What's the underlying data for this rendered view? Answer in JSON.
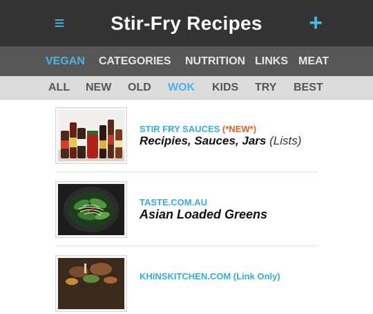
{
  "header": {
    "title": "Stir-Fry Recipes",
    "menu_icon": "≡",
    "add_icon": "+"
  },
  "colors": {
    "accent": "#49b6e3",
    "header_bg": "#333333",
    "nav_bg": "#575757",
    "subnav_bg": "#dcdcdc",
    "new_tag": "#e0612a"
  },
  "nav": {
    "items": [
      {
        "label": "VEGAN",
        "active": true
      },
      {
        "label": "CATEGORIES",
        "active": false
      },
      {
        "label": "NUTRITION",
        "active": false
      },
      {
        "label": "LINKS",
        "active": false
      },
      {
        "label": "MEAT",
        "active": false
      }
    ]
  },
  "subnav": {
    "items": [
      {
        "label": "ALL",
        "active": false
      },
      {
        "label": "NEW",
        "active": false
      },
      {
        "label": "OLD",
        "active": false
      },
      {
        "label": "WOK",
        "active": true
      },
      {
        "label": "KIDS",
        "active": false
      },
      {
        "label": "TRY",
        "active": false
      },
      {
        "label": "BEST",
        "active": false
      }
    ]
  },
  "posts": [
    {
      "source": "STIR FRY SAUCES",
      "tag": "(*NEW*)",
      "title": "Recipies, Sauces, Jars",
      "suffix": "(Lists)",
      "image": "sauce-bottles"
    },
    {
      "source": "TASTE.COM.AU",
      "tag": "",
      "title": "Asian Loaded Greens",
      "suffix": "",
      "image": "greens-in-wok"
    },
    {
      "source": "KHINSKITCHEN.COM",
      "tag": "(Link Only)",
      "title": "",
      "suffix": "",
      "image": "stir-fry-dish"
    }
  ]
}
